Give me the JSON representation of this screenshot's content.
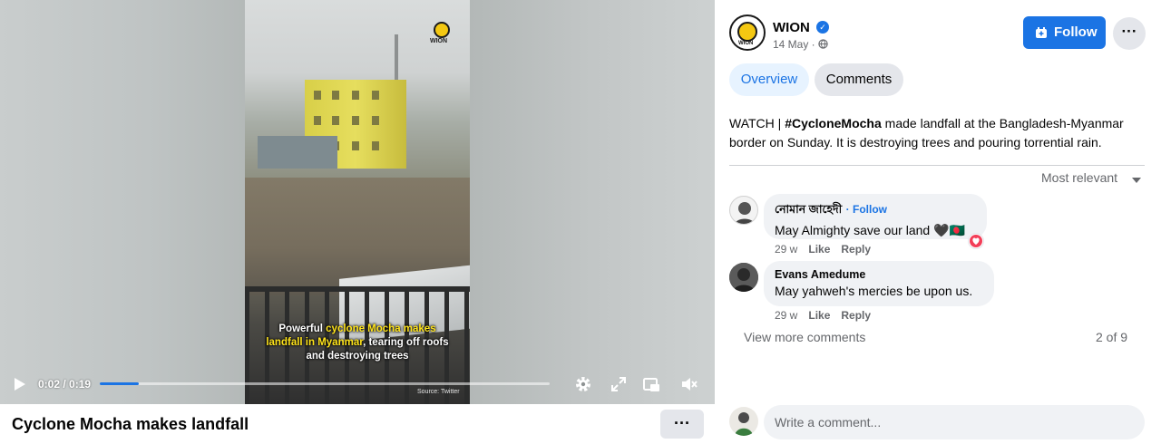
{
  "video": {
    "watermark": "WION",
    "caption_line1_plain": "Powerful ",
    "caption_line1_highlight": "cyclone Mocha makes",
    "caption_line2_highlight": "landfall in Myanmar",
    "caption_line2_plain": ", tearing off roofs",
    "caption_line3": "and destroying trees",
    "source": "Source: Twitter",
    "time": "0:02 / 0:19",
    "progress_fraction": 0.086,
    "icons": [
      "play-icon",
      "settings-gear-icon",
      "fullscreen-expand-icon",
      "picture-in-picture-icon",
      "volume-muted-icon"
    ]
  },
  "post_title": "Cyclone Mocha makes landfall",
  "more_label": "···",
  "page": {
    "name": "WION",
    "date": "14 May ·",
    "follow_label": "Follow"
  },
  "tabs": [
    {
      "label": "Overview",
      "active": true
    },
    {
      "label": "Comments",
      "active": false
    }
  ],
  "post": {
    "prefix": "WATCH | ",
    "hashtag": "#CycloneMocha",
    "text": " made landfall at the Bangladesh-Myanmar border on Sunday. It is destroying trees and pouring torrential rain."
  },
  "sort_label": "Most relevant",
  "comments": [
    {
      "author": "নোমান জাহেদী",
      "follow": "· Follow",
      "text": "May Almighty save our land 🖤🇧🇩",
      "age": "29 w",
      "like": "Like",
      "reply": "Reply",
      "reaction": "love"
    },
    {
      "author": "Evans Amedume",
      "text": "May yahweh's mercies be upon us.",
      "age": "29 w",
      "like": "Like",
      "reply": "Reply"
    }
  ],
  "view_more": "View more comments",
  "count": "2 of 9",
  "comment_placeholder": "Write a comment...",
  "colors": {
    "accent": "#1b74e4",
    "caption_highlight": "#ffe41b",
    "love": "#f33e58"
  }
}
